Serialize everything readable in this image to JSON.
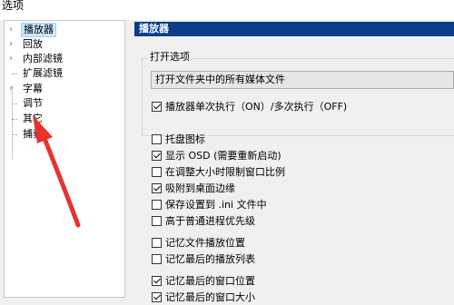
{
  "window": {
    "title": "选项"
  },
  "tree": {
    "items": [
      {
        "label": "播放器",
        "expandable": true,
        "selected": true
      },
      {
        "label": "回放",
        "expandable": true
      },
      {
        "label": "内部滤镜",
        "expandable": true
      },
      {
        "label": "扩展滤镜",
        "expandable": false
      },
      {
        "label": "字幕",
        "expandable": true
      },
      {
        "label": "调节",
        "expandable": false
      },
      {
        "label": "其它",
        "expandable": false
      },
      {
        "label": "捕获",
        "expandable": false
      }
    ]
  },
  "panel": {
    "header": "播放器",
    "open_options": {
      "group_title": "打开选项",
      "dropdown_value": "打开文件夹中的所有媒体文件",
      "single_instance": {
        "label": "播放器单次执行（ON）/多次执行（OFF)",
        "checked": true
      }
    },
    "checkboxes": [
      {
        "label": "托盘图标",
        "checked": false
      },
      {
        "label": "显示 OSD (需要重新启动)",
        "checked": true
      },
      {
        "label": "在调整大小时限制窗口比例",
        "checked": false
      },
      {
        "label": "吸附到桌面边缘",
        "checked": true
      },
      {
        "label": "保存设置到 .ini 文件中",
        "checked": false
      },
      {
        "label": "高于普通进程优先级",
        "checked": false
      },
      {
        "label": "记忆文件播放位置",
        "checked": false
      },
      {
        "label": "记忆最后的播放列表",
        "checked": false
      },
      {
        "label": "记忆最后的窗口位置",
        "checked": true
      },
      {
        "label": "记忆最后的窗口大小",
        "checked": true
      }
    ]
  },
  "colors": {
    "header_bg": "#0a3c8a",
    "selection_bg": "#cce8ff",
    "annotation_arrow": "#e8322e"
  }
}
